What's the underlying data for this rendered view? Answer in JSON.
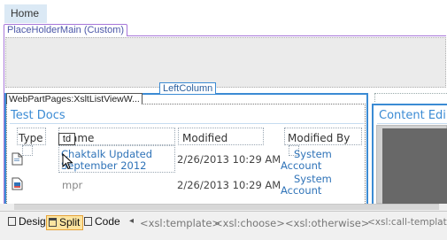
{
  "nav": {
    "home_tab": "Home"
  },
  "placeholder": {
    "label": "PlaceHolderMain (Custom)"
  },
  "left_column": {
    "label": "LeftColumn"
  },
  "webpart": {
    "tag": "WebPartPages:XsltListViewW...",
    "title": "Test Docs",
    "columns": [
      "Type",
      "Name",
      "Modified",
      "Modified By"
    ],
    "td_tag": "td",
    "rows": [
      {
        "name_line1": "Chaktalk Updated",
        "name_line2": "September 2012",
        "modified": "2/26/2013 10:29 AM",
        "modified_by_line1": "System",
        "modified_by_line2": "Account",
        "type_icon": "document-icon"
      },
      {
        "name": "mpr",
        "modified": "2/26/2013 10:29 AM",
        "modified_by_line1": "System",
        "modified_by_line2": "Account",
        "type_icon": "image-file-icon"
      }
    ]
  },
  "content_editor": {
    "title": "Content Edi"
  },
  "views": {
    "design": "Design",
    "split": "Split",
    "code": "Code",
    "active": "Split"
  },
  "breadcrumbs": [
    "<xsl:template>",
    "<xsl:choose>",
    "<xsl:otherwise>",
    "<xsl:call-template>"
  ],
  "colors": {
    "accent": "#3b8bd4",
    "placeholder_border": "#a777d9",
    "active_view": "#fce4a0"
  }
}
